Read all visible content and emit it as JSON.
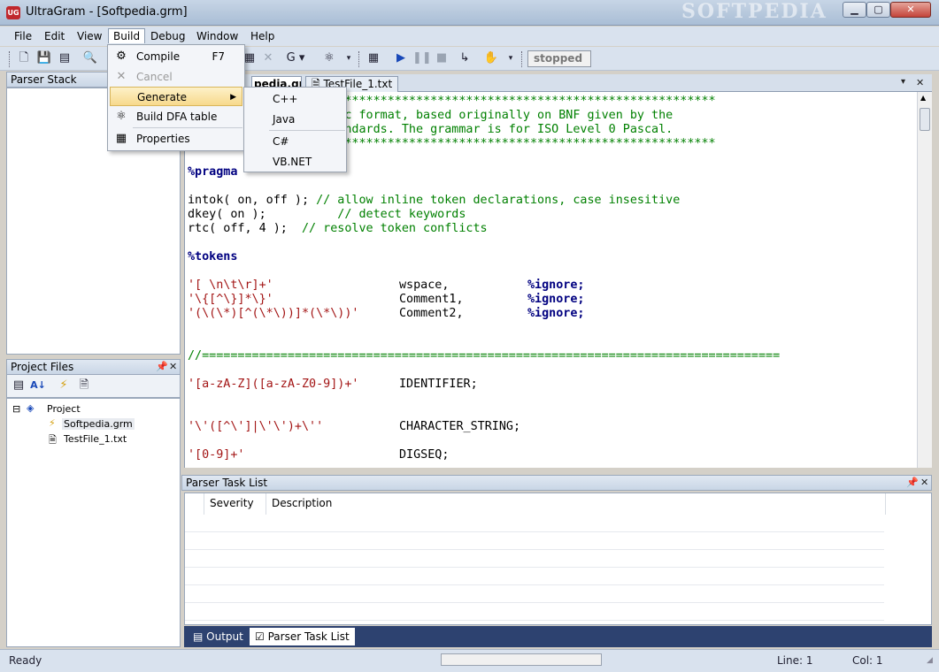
{
  "window": {
    "title": "UltraGram - [Softpedia.grm]",
    "app_icon": "UG",
    "watermark": "SOFTPEDIA",
    "controls": {
      "minimize": "▁",
      "maximize": "▢",
      "close": "✕"
    }
  },
  "menubar": {
    "items": [
      "File",
      "Edit",
      "View",
      "Build",
      "Debug",
      "Window",
      "Help"
    ],
    "active": "Build"
  },
  "build_menu": {
    "items": [
      {
        "label": "Compile",
        "shortcut": "F7",
        "icon": "compile-icon",
        "glyph": "⚙",
        "disabled": false
      },
      {
        "label": "Cancel",
        "shortcut": "",
        "icon": "cancel-icon",
        "glyph": "✕",
        "disabled": true
      },
      {
        "label": "Generate",
        "shortcut": "",
        "icon": "",
        "glyph": "",
        "submenu": true
      },
      {
        "label": "Build DFA table",
        "shortcut": "",
        "icon": "dfa-icon",
        "glyph": "⚛",
        "disabled": false
      },
      {
        "label": "Properties",
        "shortcut": "",
        "icon": "properties-icon",
        "glyph": "▦",
        "disabled": false
      }
    ],
    "generate_submenu": [
      "C++",
      "Java",
      "C#",
      "VB.NET"
    ]
  },
  "toolbar": {
    "status": "stopped",
    "g_label": "G"
  },
  "parser_stack": {
    "title": "Parser Stack"
  },
  "project_files": {
    "title": "Project Files",
    "tree": {
      "root": "Project",
      "children": [
        "Softpedia.grm",
        "TestFile_1.txt"
      ]
    }
  },
  "editor": {
    "tabs": [
      "Softpedia.grm",
      "TestFile_1.txt"
    ],
    "active_tab": "Softpedia.grm",
    "active_tab_visible_text": "pedia.grm",
    "lines": [
      {
        "cls": "c-green",
        "text": "                   *******************************************************"
      },
      {
        "cls": "c-green",
        "text": "                   Yacc format, based originally on BNF given by the"
      },
      {
        "cls": "c-green",
        "text": "                al standards. The grammar is for ISO Level 0 Pascal."
      },
      {
        "cls": "c-green",
        "text": "                   *******************************************************"
      },
      {
        "cls": "",
        "text": ""
      },
      {
        "cls": "c-kw",
        "text": "%pragma"
      },
      {
        "cls": "",
        "text": ""
      },
      {
        "cls": "mix1",
        "text": ""
      },
      {
        "cls": "mix2",
        "text": ""
      },
      {
        "cls": "mix3",
        "text": ""
      },
      {
        "cls": "",
        "text": ""
      },
      {
        "cls": "c-kw",
        "text": "%tokens"
      },
      {
        "cls": "",
        "text": ""
      },
      {
        "cls": "tok1",
        "text": ""
      },
      {
        "cls": "tok2",
        "text": ""
      },
      {
        "cls": "tok3",
        "text": ""
      },
      {
        "cls": "",
        "text": ""
      },
      {
        "cls": "",
        "text": ""
      },
      {
        "cls": "c-green",
        "text": "//================================================================================="
      },
      {
        "cls": "",
        "text": ""
      },
      {
        "cls": "tok4",
        "text": ""
      },
      {
        "cls": "",
        "text": ""
      },
      {
        "cls": "",
        "text": ""
      },
      {
        "cls": "tok5",
        "text": ""
      },
      {
        "cls": "",
        "text": ""
      },
      {
        "cls": "tok6",
        "text": ""
      }
    ],
    "pragma_lines": [
      {
        "code": "intok( on, off );",
        "comment": " // allow inline token declarations, case insesitive"
      },
      {
        "code": "dkey( on );",
        "comment": "          // detect keywords"
      },
      {
        "code": "rtc( off, 4 );",
        "comment": "  // resolve token conflicts"
      }
    ],
    "token_lines": [
      {
        "regex": "'[ \\n\\t\\r]+'",
        "name": "wspace,",
        "flag": "%ignore;"
      },
      {
        "regex": "'\\{[^\\}]*\\}'",
        "name": "Comment1,",
        "flag": "%ignore;"
      },
      {
        "regex": "'(\\(\\*)[^(\\*\\))]*(\\*\\))'",
        "name": "Comment2,",
        "flag": "%ignore;"
      },
      {
        "regex": "'[a-zA-Z]([a-zA-Z0-9])+'",
        "name": "IDENTIFIER;",
        "flag": ""
      },
      {
        "regex": "'\\'([^\\']|\\'\\')+\\''",
        "name": "CHARACTER_STRING;",
        "flag": ""
      },
      {
        "regex": "'[0-9]+'",
        "name": "DIGSEQ;",
        "flag": ""
      }
    ]
  },
  "task_list": {
    "title": "Parser Task List",
    "columns": [
      "Severity",
      "Description"
    ]
  },
  "bottom_tabs": [
    "Output",
    "Parser Task List"
  ],
  "statusbar": {
    "ready": "Ready",
    "line": "Line: 1",
    "col": "Col: 1"
  }
}
